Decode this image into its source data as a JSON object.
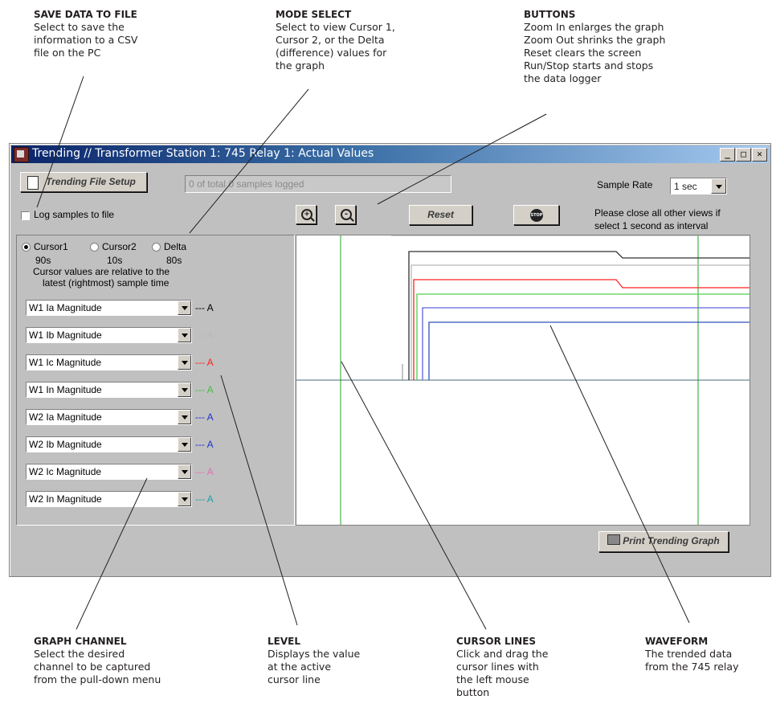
{
  "callouts": {
    "save": {
      "title": "SAVE DATA TO FILE",
      "body": "Select to save the\ninformation to a CSV\nfile on the PC"
    },
    "mode": {
      "title": "MODE SELECT",
      "body": "Select to view Cursor 1,\nCursor 2, or the Delta\n(difference) values for\nthe graph"
    },
    "buttons": {
      "title": "BUTTONS",
      "body": "Zoom In enlarges the graph\nZoom Out shrinks the graph\nReset clears the screen\nRun/Stop starts and stops\nthe data logger"
    },
    "channel": {
      "title": "GRAPH CHANNEL",
      "body": "Select the desired\nchannel to be captured\nfrom the pull-down menu"
    },
    "level": {
      "title": "LEVEL",
      "body": "Displays the value\nat the active\ncursor line"
    },
    "cursor": {
      "title": "CURSOR LINES",
      "body": "Click and drag the\ncursor lines with\nthe left mouse\nbutton"
    },
    "waveform": {
      "title": "WAVEFORM",
      "body": "The trended data\nfrom the 745 relay"
    }
  },
  "window": {
    "title": "Trending // Transformer Station 1: 745 Relay 1: Actual Values",
    "controls": {
      "minimize": "_",
      "maximize": "□",
      "close": "✕"
    }
  },
  "toolbar": {
    "setup_label": "Trending File Setup",
    "samples_status": "0 of total 0 samples logged",
    "log_checkbox_label": "Log samples to file",
    "log_checked": false,
    "zoom_in_icon": "zoom-in-icon",
    "zoom_out_icon": "zoom-out-icon",
    "reset_label": "Reset",
    "stop_icon_text": "STOP",
    "sample_rate_label": "Sample Rate",
    "sample_rate_value": "1 sec",
    "interval_note_line1": "Please close all other views if",
    "interval_note_line2": "select 1 second as interval"
  },
  "cursor_panel": {
    "modes": [
      {
        "label": "Cursor1",
        "selected": true
      },
      {
        "label": "Cursor2",
        "selected": false
      },
      {
        "label": "Delta",
        "selected": false
      }
    ],
    "times": [
      "90s",
      "10s",
      "80s"
    ],
    "note_line1": "Cursor values are relative to the",
    "note_line2": "latest (rightmost) sample time"
  },
  "channels": [
    {
      "name": "W1 Ia Magnitude",
      "level": "--- A",
      "color": "#000000"
    },
    {
      "name": "W1 Ib Magnitude",
      "level": "--- A",
      "color": "#b8b8b8"
    },
    {
      "name": "W1 Ic Magnitude",
      "level": "--- A",
      "color": "#ff2020"
    },
    {
      "name": "W1 In Magnitude",
      "level": "--- A",
      "color": "#40c040"
    },
    {
      "name": "W2 Ia Magnitude",
      "level": "--- A",
      "color": "#2030d0"
    },
    {
      "name": "W2 Ib Magnitude",
      "level": "--- A",
      "color": "#2030d0"
    },
    {
      "name": "W2 Ic Magnitude",
      "level": "--- A",
      "color": "#e070b0"
    },
    {
      "name": "W2 In Magnitude",
      "level": "--- A",
      "color": "#20a0a0"
    }
  ],
  "graph": {
    "cursor_color": "#20a020",
    "trace_colors": [
      "#303030",
      "#b8b8b8",
      "#ff2020",
      "#50d050",
      "#6060e0",
      "#3050c0"
    ]
  },
  "print_label": "Print Trending Graph"
}
